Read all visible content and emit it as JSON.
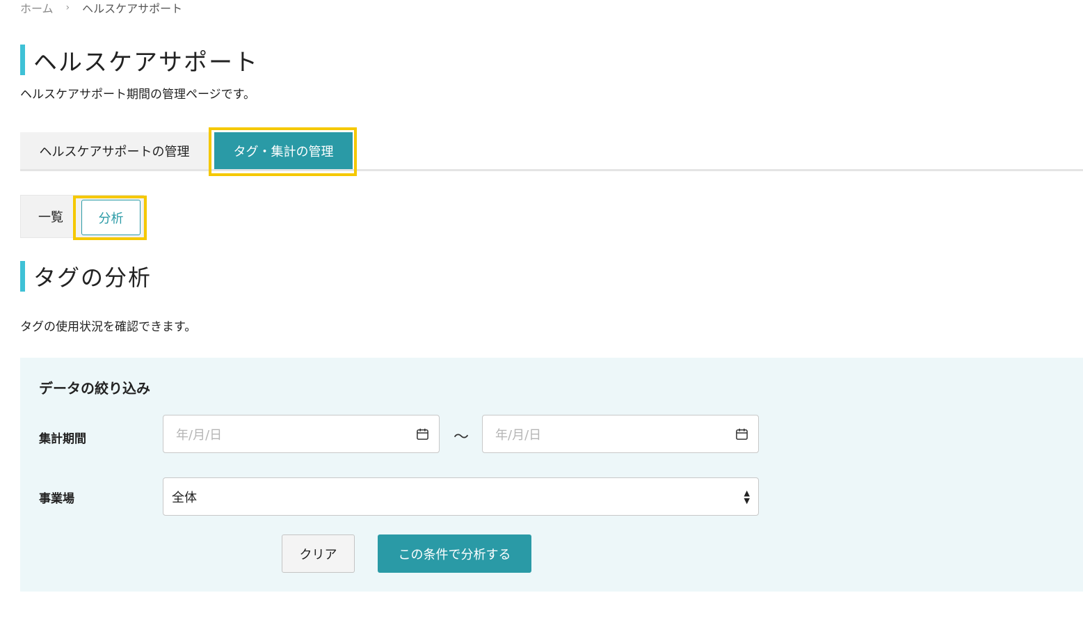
{
  "breadcrumb": {
    "home": "ホーム",
    "separator": "›",
    "current": "ヘルスケアサポート"
  },
  "page": {
    "title": "ヘルスケアサポート",
    "description": "ヘルスケアサポート期間の管理ページです。"
  },
  "main_tabs": [
    {
      "label": "ヘルスケアサポートの管理",
      "active": false
    },
    {
      "label": "タグ・集計の管理",
      "active": true
    }
  ],
  "sub_tabs": [
    {
      "label": "一覧",
      "active": false
    },
    {
      "label": "分析",
      "active": true
    }
  ],
  "section": {
    "title": "タグの分析",
    "description": "タグの使用状況を確認できます。"
  },
  "filter": {
    "title": "データの絞り込み",
    "period_label": "集計期間",
    "start_placeholder": "年/月/日",
    "end_placeholder": "年/月/日",
    "range_separator": "～",
    "site_label": "事業場",
    "site_value": "全体",
    "clear_label": "クリア",
    "analyze_label": "この条件で分析する"
  },
  "colors": {
    "accent_bar": "#3fc1d6",
    "primary": "#2a9aa6",
    "highlight": "#f5c800",
    "panel_bg": "#edf7f9"
  },
  "icons": {
    "calendar": "calendar-icon",
    "select_arrows": "select-arrows-icon",
    "breadcrumb_separator": "chevron-right-icon"
  }
}
